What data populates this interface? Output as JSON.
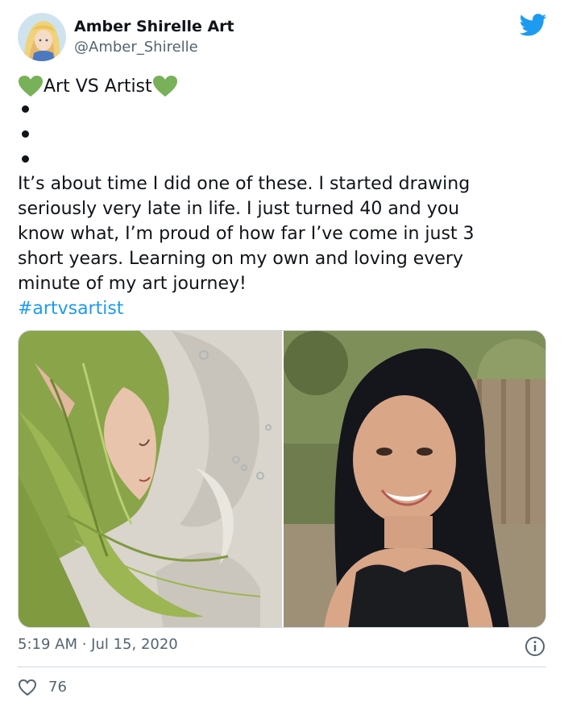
{
  "author": {
    "name": "Amber Shirelle Art",
    "handle": "@Amber_Shirelle"
  },
  "icons": {
    "bird": "twitter-bird-icon",
    "heart_emoji": "green-heart-icon",
    "info": "info-icon",
    "like": "like-heart-icon"
  },
  "tweet": {
    "title": "Art VS Artist",
    "paragraph": "It’s about time I did one of these. I started drawing\nseriously very late in life. I just turned 40 and you\nknow what, I’m proud of how far I’ve come in just 3\nshort years. Learning on my own and loving every\nminute of my art journey!",
    "hashtag": "#artvsartist"
  },
  "footer": {
    "timestamp": "5:19 AM · Jul 15, 2020",
    "likes": "76"
  },
  "colors": {
    "brand_blue": "#1d9bf0",
    "heart_green": "#78b159",
    "secondary_text": "#536471"
  }
}
